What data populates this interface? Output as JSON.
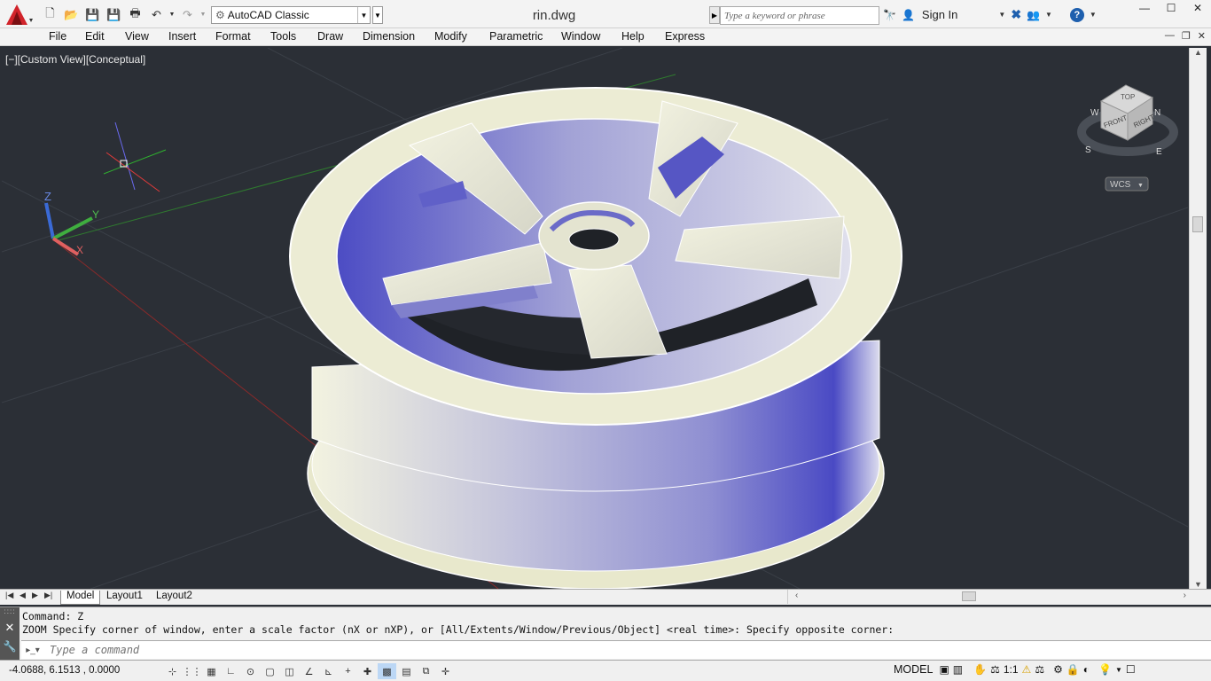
{
  "app": {
    "title": "rin.dwg",
    "workspace": "AutoCAD Classic"
  },
  "search": {
    "placeholder": "Type a keyword or phrase"
  },
  "account": {
    "sign_in": "Sign In"
  },
  "menu": [
    "File",
    "Edit",
    "View",
    "Insert",
    "Format",
    "Tools",
    "Draw",
    "Dimension",
    "Modify",
    "Parametric",
    "Window",
    "Help",
    "Express"
  ],
  "viewport": {
    "label": "[−][Custom View][Conceptual]",
    "ucs": {
      "x_label": "X",
      "y_label": "Y",
      "z_label": "Z"
    },
    "viewcube": {
      "top": "TOP",
      "front": "FRONT",
      "right": "RIGHT",
      "compass_w": "W",
      "compass_n": "N",
      "compass_s": "S",
      "compass_e": "E"
    },
    "wcs": "WCS"
  },
  "tabs": {
    "items": [
      "Model",
      "Layout1",
      "Layout2"
    ],
    "active": "Model"
  },
  "command": {
    "history_1": "Command: Z",
    "history_2": "ZOOM Specify corner of window, enter a scale factor (nX or nXP), or [All/Extents/Window/Previous/Object] <real time>: Specify opposite corner:",
    "placeholder": "Type a command"
  },
  "status": {
    "coords": "-4.0688, 6.1513 , 0.0000",
    "model": "MODEL",
    "scale": "1:1"
  },
  "colors": {
    "viewport_bg": "#2b2f36",
    "rim_light": "#ececd4",
    "rim_shade": "#5a5ac8",
    "ribbon_bg": "#f3f3f3"
  }
}
